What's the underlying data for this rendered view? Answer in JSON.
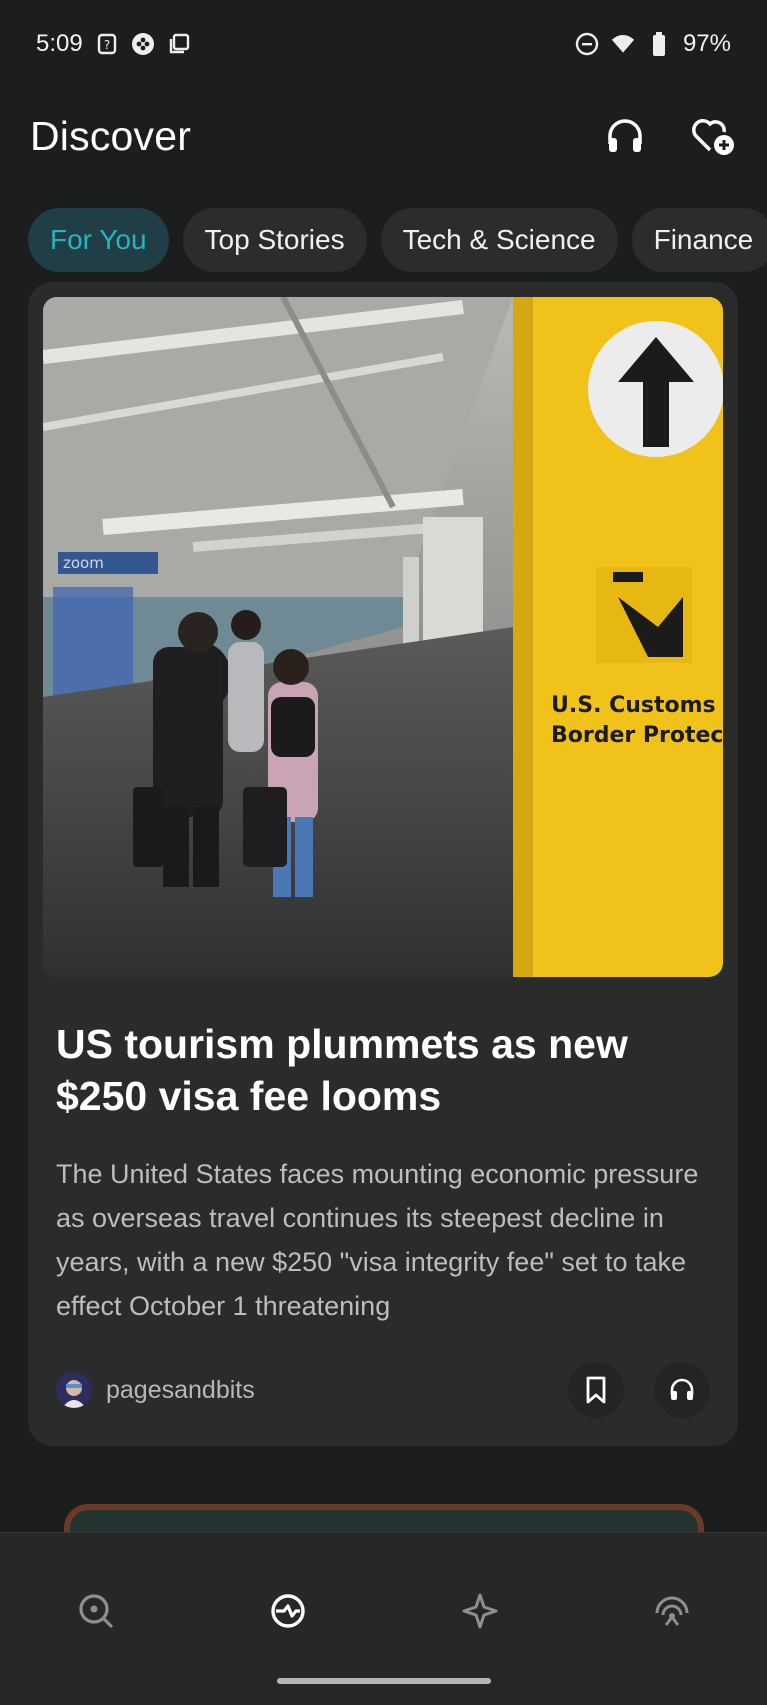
{
  "status_bar": {
    "time": "5:09",
    "battery": "97%"
  },
  "header": {
    "title": "Discover"
  },
  "tabs": [
    {
      "label": "For You",
      "active": true
    },
    {
      "label": "Top Stories",
      "active": false
    },
    {
      "label": "Tech & Science",
      "active": false
    },
    {
      "label": "Finance",
      "active": false
    }
  ],
  "article": {
    "image_sign_text_line1": "U.S. Customs and",
    "image_sign_text_line2": "Border Protection",
    "image_zoom_text": "zoom",
    "headline": "US tourism plummets as new $250 visa fee looms",
    "summary": "The United States faces mounting economic pressure as overseas travel continues its steepest decline in years, with a new $250 \"visa integrity fee\" set to take effect October 1 threatening",
    "source": "pagesandbits"
  },
  "colors": {
    "accent": "#2bb1c2",
    "background": "#1c1d1d",
    "card": "#2a2b2b",
    "sign_yellow": "#f0c21a"
  }
}
